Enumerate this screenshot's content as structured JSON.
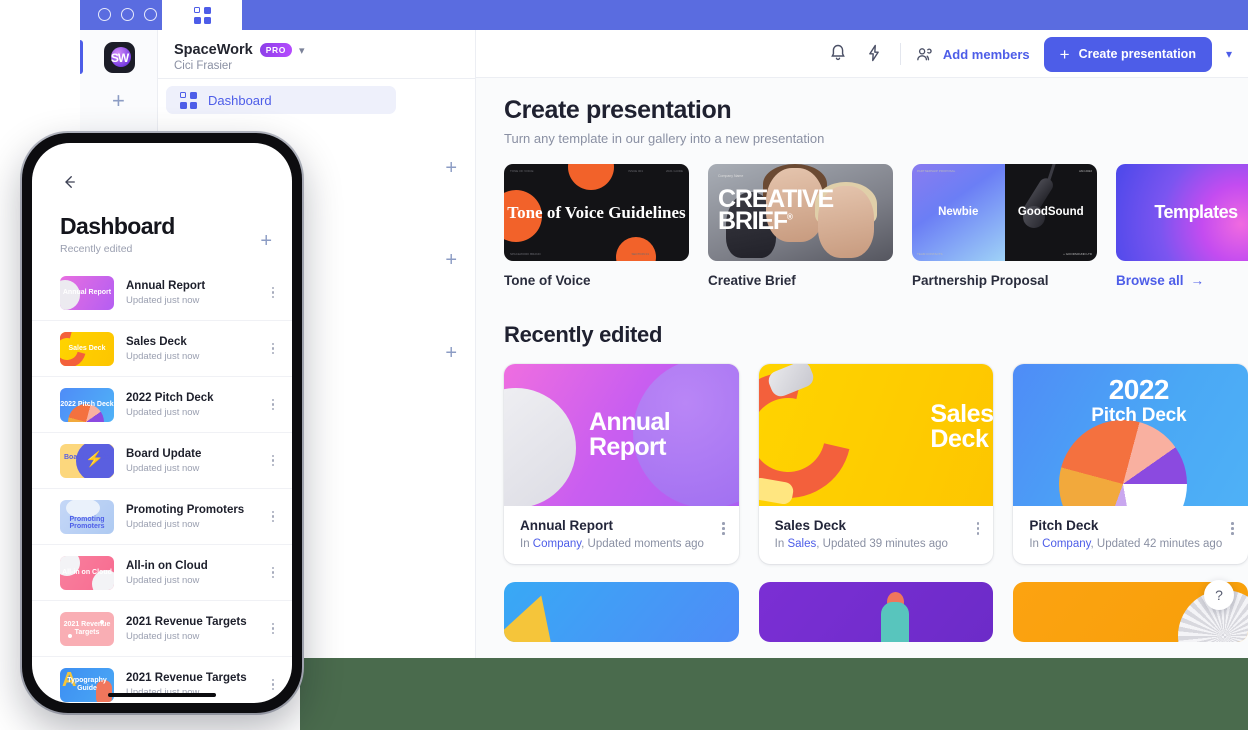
{
  "window": {
    "tab_icon": "grid-icon",
    "traffic_lights": [
      "close",
      "minimize",
      "maximize"
    ]
  },
  "rail": {
    "logo_text": "SW",
    "add_label": "+"
  },
  "sidebar": {
    "workspace_name": "SpaceWork",
    "plan_badge": "PRO",
    "user_name": "Cici Frasier",
    "nav": [
      {
        "label": "Dashboard",
        "icon": "grid-icon",
        "active": true
      }
    ],
    "add_buttons": [
      "+",
      "+",
      "+"
    ]
  },
  "topbar": {
    "notifications_icon": "bell-icon",
    "activity_icon": "lightning-icon",
    "add_members_label": "Add members",
    "add_members_icon": "people-icon",
    "create_label": "Create presentation",
    "create_plus": "+",
    "dropdown_icon": "chevron-down-icon"
  },
  "create_section": {
    "title": "Create presentation",
    "subtitle": "Turn any template in our gallery into a new presentation",
    "templates": [
      {
        "label": "Tone of Voice",
        "thumb_title": "Tone of Voice Guidelines",
        "style": "tone-of-voice"
      },
      {
        "label": "Creative Brief",
        "thumb_title": "CREATIVE BRIEF",
        "style": "creative-brief"
      },
      {
        "label": "Partnership Proposal",
        "thumb_left": "Newbie",
        "thumb_right": "GoodSound",
        "style": "partnership"
      },
      {
        "label": "Browse all",
        "thumb_title": "Templates",
        "style": "templates-stack",
        "is_link": true,
        "arrow": "→"
      }
    ]
  },
  "recent_section": {
    "title": "Recently edited",
    "cards": [
      {
        "title": "Annual Report",
        "thumb_title": "Annual Report",
        "folder_prefix": "In ",
        "folder": "Company",
        "updated": ", Updated moments ago",
        "style": "annual-report"
      },
      {
        "title": "Sales Deck",
        "thumb_title": "Sales Deck",
        "folder_prefix": "In ",
        "folder": "Sales",
        "updated": ", Updated 39 minutes ago",
        "style": "sales-deck"
      },
      {
        "title": "Pitch Deck",
        "thumb_year": "2022",
        "thumb_sub": "Pitch Deck",
        "folder_prefix": "In ",
        "folder": "Company",
        "updated": ", Updated 42 minutes ago",
        "style": "pitch-deck"
      }
    ],
    "next_row": [
      {
        "style": "blue-triangle"
      },
      {
        "style": "purple-figure"
      },
      {
        "style": "orange-ball"
      }
    ]
  },
  "help_button": {
    "label": "?"
  },
  "phone": {
    "back_icon": "arrow-left-icon",
    "title": "Dashboard",
    "subtitle": "Recently edited",
    "add_label": "+",
    "items": [
      {
        "name": "Annual Report",
        "updated": "Updated just now",
        "thumb_text": "Annual Report",
        "style": "th-ar"
      },
      {
        "name": "Sales Deck",
        "updated": "Updated just now",
        "thumb_text": "Sales Deck",
        "style": "th-sd"
      },
      {
        "name": "2022 Pitch Deck",
        "updated": "Updated just now",
        "thumb_text": "2022 Pitch Deck",
        "style": "th-pd"
      },
      {
        "name": "Board Update",
        "updated": "Updated just now",
        "thumb_text": "Board Update",
        "style": "th-bu"
      },
      {
        "name": "Promoting Promoters",
        "updated": "Updated just now",
        "thumb_text": "Promoting Promoters",
        "style": "th-pp"
      },
      {
        "name": "All-in on Cloud",
        "updated": "Updated just now",
        "thumb_text": "All-in on Cloud",
        "style": "th-ac"
      },
      {
        "name": "2021 Revenue Targets",
        "updated": "Updated just now",
        "thumb_text": "2021 Revenue Targets",
        "style": "th-rt"
      },
      {
        "name": "2021 Revenue Targets",
        "updated": "Updated just now",
        "thumb_text": "Typography Guide",
        "style": "th-tg"
      }
    ]
  },
  "colors": {
    "accent": "#4d5de8",
    "chrome": "#5a6ce0",
    "backdrop": "#4a6b4d",
    "pro_badge": "#8b3fe8"
  }
}
